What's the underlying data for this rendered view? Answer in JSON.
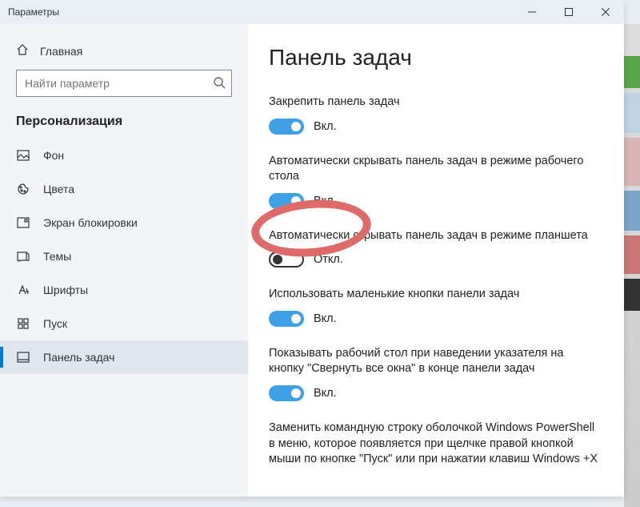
{
  "window": {
    "title": "Параметры"
  },
  "sidebar": {
    "home": "Главная",
    "search_placeholder": "Найти параметр",
    "section": "Персонализация",
    "items": [
      {
        "label": "Фон"
      },
      {
        "label": "Цвета"
      },
      {
        "label": "Экран блокировки"
      },
      {
        "label": "Темы"
      },
      {
        "label": "Шрифты"
      },
      {
        "label": "Пуск"
      },
      {
        "label": "Панель задач"
      }
    ]
  },
  "main": {
    "heading": "Панель задач",
    "state_on": "Вкл.",
    "state_off": "Откл.",
    "settings": [
      {
        "label": "Закрепить панель задач",
        "on": true,
        "state": "Вкл."
      },
      {
        "label": "Автоматически скрывать панель задач в режиме рабочего стола",
        "on": true,
        "state": "Вкл."
      },
      {
        "label": "Автоматически скрывать панель задач в режиме планшета",
        "on": false,
        "state": "Откл."
      },
      {
        "label": "Использовать маленькие кнопки панели задач",
        "on": true,
        "state": "Вкл."
      },
      {
        "label": "Показывать рабочий стол при наведении указателя на кнопку \"Свернуть все окна\" в конце панели задач",
        "on": true,
        "state": "Вкл."
      },
      {
        "label": "Заменить командную строку оболочкой Windows PowerShell в меню, которое появляется при щелчке правой кнопкой мыши по кнопке \"Пуск\" или при нажатии клавиш Windows +X"
      }
    ]
  },
  "colors": {
    "accent": "#0078d4",
    "toggle_on": "#3ea1e6",
    "annotation": "#df6a6a"
  }
}
